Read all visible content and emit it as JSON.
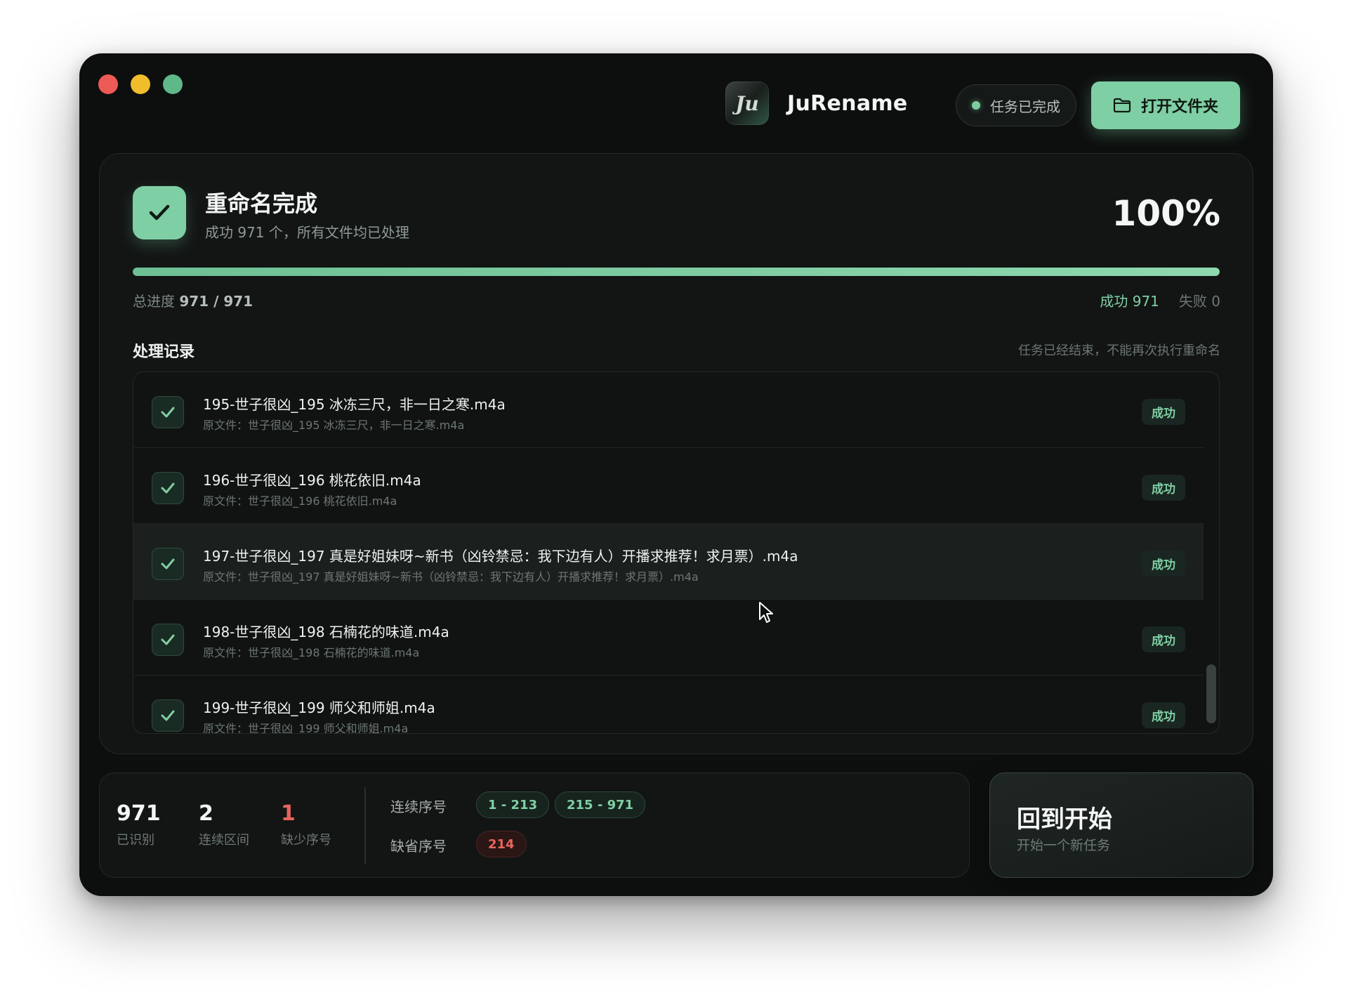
{
  "app": {
    "name": "JuRename",
    "logo_text": "Ju"
  },
  "header": {
    "status_label": "任务已完成",
    "open_folder_label": "打开文件夹"
  },
  "summary": {
    "title": "重命名完成",
    "subtitle": "成功 971 个，所有文件均已处理",
    "percent": "100%",
    "progress": 1.0,
    "progress_label": "总进度",
    "progress_value": "971 / 971",
    "success_label": "成功 971",
    "fail_label": "失败 0"
  },
  "records": {
    "title": "处理记录",
    "note": "任务已经结束，不能再次执行重命名",
    "items": [
      {
        "name": "195-世子很凶_195 冰冻三尺，非一日之寒.m4a",
        "original": "原文件：世子很凶_195 冰冻三尺，非一日之寒.m4a",
        "status": "成功"
      },
      {
        "name": "196-世子很凶_196 桃花依旧.m4a",
        "original": "原文件：世子很凶_196 桃花依旧.m4a",
        "status": "成功"
      },
      {
        "name": "197-世子很凶_197 真是好姐妹呀~新书（凶铃禁忌：我下边有人）开播求推荐！求月票）.m4a",
        "original": "原文件：世子很凶_197 真是好姐妹呀~新书（凶铃禁忌：我下边有人）开播求推荐！求月票）.m4a",
        "status": "成功"
      },
      {
        "name": "198-世子很凶_198 石楠花的味道.m4a",
        "original": "原文件：世子很凶_198 石楠花的味道.m4a",
        "status": "成功"
      },
      {
        "name": "199-世子很凶_199 师父和师姐.m4a",
        "original": "原文件：世子很凶_199 师父和师姐.m4a",
        "status": "成功"
      }
    ]
  },
  "stats": {
    "recognized": {
      "value": "971",
      "label": "已识别"
    },
    "ranges": {
      "value": "2",
      "label": "连续区间"
    },
    "missing": {
      "value": "1",
      "label": "缺少序号"
    },
    "continuous_label": "连续序号",
    "continuous_ranges": [
      "1 - 213",
      "215 - 971"
    ],
    "missing_label": "缺省序号",
    "missing_values": [
      "214"
    ]
  },
  "restart": {
    "title": "回到开始",
    "subtitle": "开始一个新任务"
  },
  "colors": {
    "accent": "#7fcfa4",
    "danger": "#e8645d",
    "background": "#0d0f0e"
  }
}
